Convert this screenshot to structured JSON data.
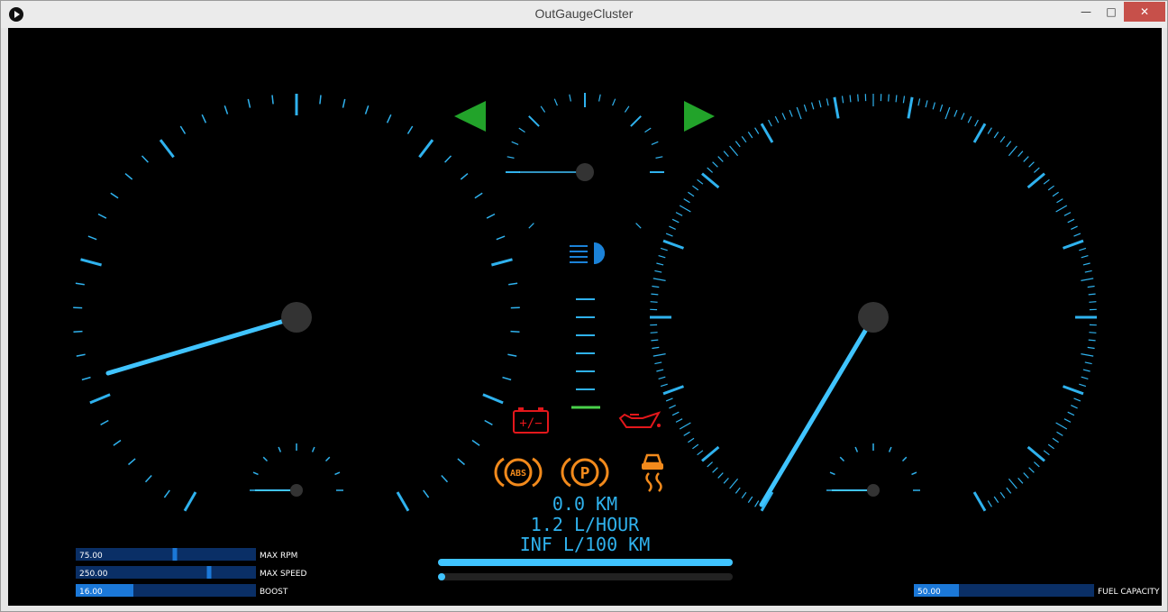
{
  "window": {
    "title": "OutGaugeCluster",
    "minimize_glyph": "—",
    "maximize_glyph": "□",
    "close_glyph": "✕"
  },
  "colors": {
    "accent": "#2fb2ee",
    "needle": "#40c4ff",
    "hub": "#333333",
    "arrow": "#22a32a",
    "warning_red": "#e3171b",
    "warning_orange": "#f28a1c",
    "headlight": "#1b82d8",
    "slider_bg": "#0a2f66",
    "slider_fill": "#1b78d8"
  },
  "indicators": {
    "left_turn": "left-arrow-icon",
    "right_turn": "right-arrow-icon",
    "headlight": "headlight-icon",
    "battery": "battery-icon",
    "battery_text": "+/−",
    "oil": "oil-can-icon",
    "abs": "abs-icon",
    "abs_text": "ABS",
    "parking": "parking-brake-icon",
    "parking_text": "P",
    "traction": "traction-control-icon"
  },
  "readouts": {
    "distance": "0.0 KM",
    "fuel_rate": "1.2 L/HOUR",
    "fuel_economy": "INF L/100 KM"
  },
  "center_bars": {
    "top_fill": 1.0,
    "bottom_fill": 0.0
  },
  "sliders": [
    {
      "value": "75.00",
      "label": "MAX RPM",
      "position": 0.55
    },
    {
      "value": "250.00",
      "label": "MAX SPEED",
      "position": 0.74
    },
    {
      "value": "16.00",
      "label": "BOOST",
      "position": 0.32,
      "style": "fill"
    }
  ],
  "fuel_slider": {
    "value": "50.00",
    "label": "FUEL CAPACITY",
    "position": 0.25
  }
}
